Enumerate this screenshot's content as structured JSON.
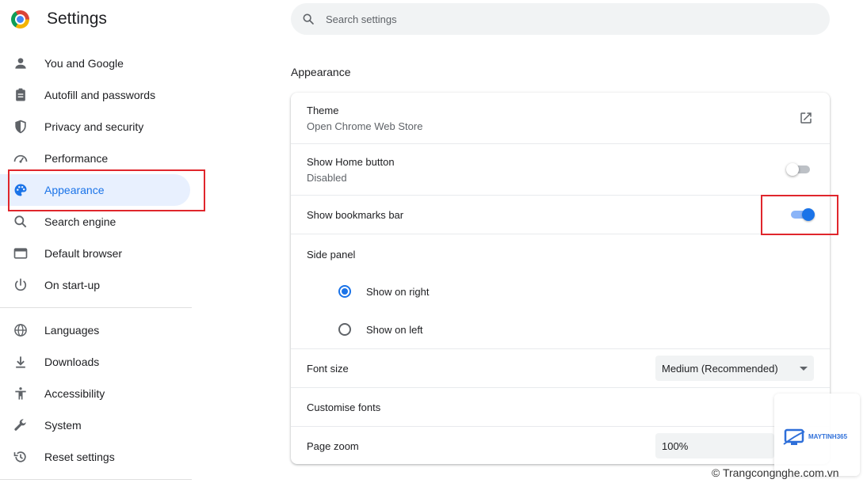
{
  "header": {
    "app_title": "Settings",
    "search_placeholder": "Search settings"
  },
  "sidebar": {
    "items": [
      {
        "label": "You and Google",
        "icon": "person-icon"
      },
      {
        "label": "Autofill and passwords",
        "icon": "clipboard-icon"
      },
      {
        "label": "Privacy and security",
        "icon": "shield-icon"
      },
      {
        "label": "Performance",
        "icon": "speedometer-icon"
      },
      {
        "label": "Appearance",
        "icon": "palette-icon",
        "active": true
      },
      {
        "label": "Search engine",
        "icon": "search-icon"
      },
      {
        "label": "Default browser",
        "icon": "browser-window-icon"
      },
      {
        "label": "On start-up",
        "icon": "power-icon"
      }
    ],
    "items2": [
      {
        "label": "Languages",
        "icon": "globe-icon"
      },
      {
        "label": "Downloads",
        "icon": "download-icon"
      },
      {
        "label": "Accessibility",
        "icon": "accessibility-icon"
      },
      {
        "label": "System",
        "icon": "wrench-icon"
      },
      {
        "label": "Reset settings",
        "icon": "history-icon"
      }
    ]
  },
  "main": {
    "section_title": "Appearance",
    "theme": {
      "label": "Theme",
      "sublabel": "Open Chrome Web Store"
    },
    "home_button": {
      "label": "Show Home button",
      "sublabel": "Disabled",
      "enabled": false
    },
    "bookmarks_bar": {
      "label": "Show bookmarks bar",
      "enabled": true
    },
    "side_panel": {
      "label": "Side panel",
      "options": [
        {
          "label": "Show on right",
          "checked": true
        },
        {
          "label": "Show on left",
          "checked": false
        }
      ]
    },
    "font_size": {
      "label": "Font size",
      "value": "Medium (Recommended)"
    },
    "customise_fonts": {
      "label": "Customise fonts"
    },
    "page_zoom": {
      "label": "Page zoom",
      "value": "100%"
    }
  },
  "colors": {
    "accent": "#1a73e8",
    "active_nav_bg": "#e8f0fe",
    "highlight_box": "#e0262c"
  },
  "watermark": {
    "brand": "MAYTINH365",
    "copyright": "© Trangcongnghe.com.vn"
  }
}
